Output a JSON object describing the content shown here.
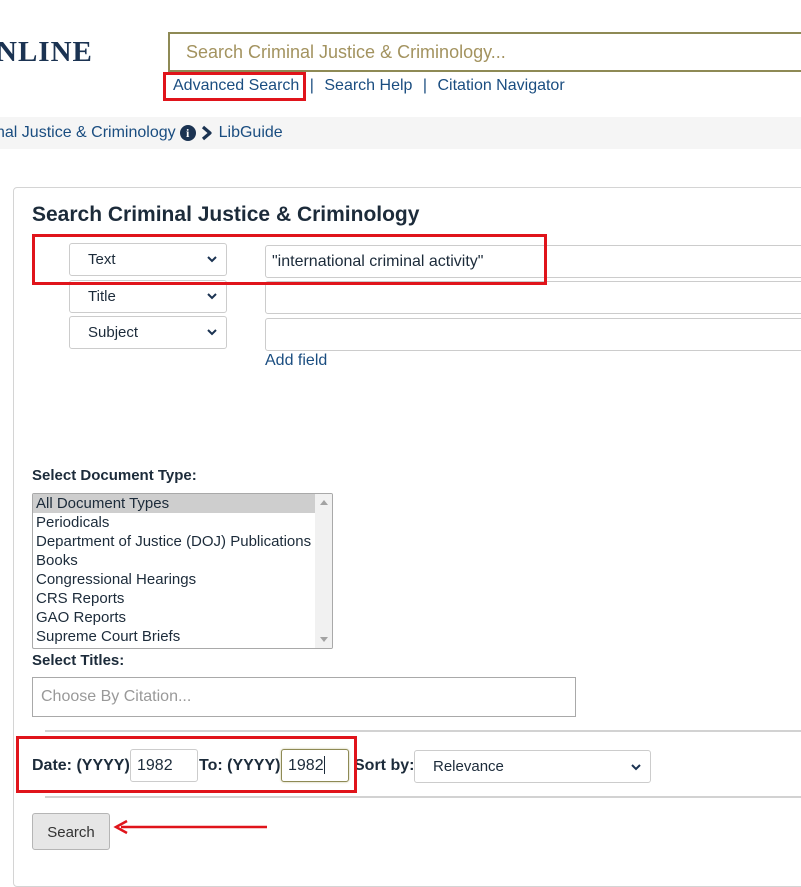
{
  "header": {
    "logo_text": "NLINE",
    "search_placeholder": "Search Criminal Justice & Criminology...",
    "links": {
      "advanced_search": "Advanced Search",
      "search_help": "Search Help",
      "citation_navigator": "Citation Navigator",
      "separator": "|"
    }
  },
  "breadcrumb": {
    "collection": "nal Justice & Criminology",
    "info_icon": "i",
    "libguide": "LibGuide"
  },
  "form": {
    "title": "Search Criminal Justice & Criminology",
    "rows": [
      {
        "field": "Text",
        "value": "\"international criminal activity\""
      },
      {
        "field": "Title",
        "value": ""
      },
      {
        "field": "Subject",
        "value": ""
      }
    ],
    "add_field": "Add field",
    "doc_type_label": "Select Document Type:",
    "doc_types": [
      "All Document Types",
      "Periodicals",
      "Department of Justice (DOJ) Publications",
      "Books",
      "Congressional Hearings",
      "CRS Reports",
      "GAO Reports",
      "Supreme Court Briefs"
    ],
    "doc_type_selected": "All Document Types",
    "titles_label": "Select Titles:",
    "titles_placeholder": "Choose By Citation...",
    "date_from_label": "Date: (YYYY)",
    "date_from_value": "1982",
    "date_to_label": "To: (YYYY)",
    "date_to_value": "1982",
    "sort_label": "Sort by:",
    "sort_value": "Relevance",
    "search_button": "Search"
  },
  "colors": {
    "link": "#1a4d80",
    "annotation_red": "#e0141b",
    "search_border": "#8e8a55",
    "navy": "#1b3352"
  }
}
